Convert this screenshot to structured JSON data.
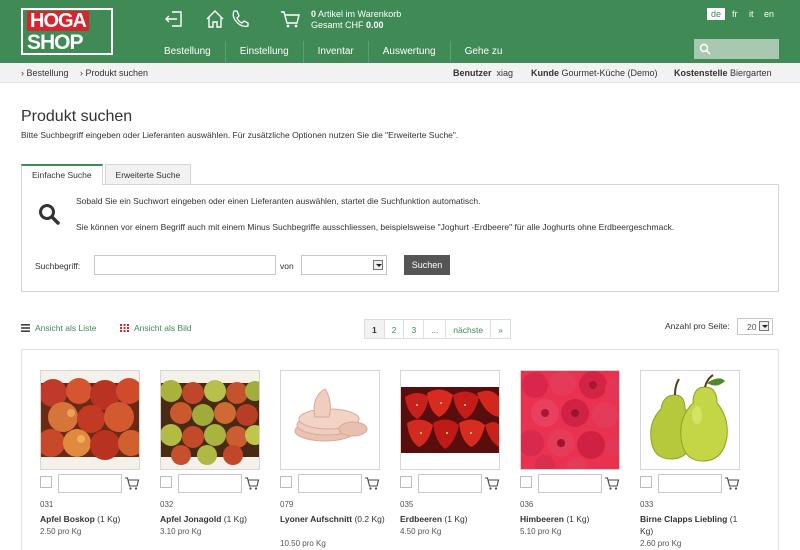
{
  "header": {
    "logo_top": "HOGA",
    "logo_bottom": "SHOP",
    "cart_count": "0",
    "cart_label": "Artikel im Warenkorb",
    "total_label": "Gesamt CHF",
    "total_value": "0.00",
    "languages": [
      "de",
      "fr",
      "it",
      "en"
    ],
    "active_language": "de",
    "nav": [
      "Bestellung",
      "Einstellung",
      "Inventar",
      "Auswertung",
      "Gehe zu"
    ]
  },
  "breadcrumb": [
    "Bestellung",
    "Produkt suchen"
  ],
  "userbar": {
    "user_label": "Benutzer",
    "user_value": "xiag",
    "customer_label": "Kunde",
    "customer_value": "Gourmet-Küche (Demo)",
    "cost_label": "Kostenstelle",
    "cost_value": "Biergarten"
  },
  "page": {
    "title": "Produkt suchen",
    "subtitle": "Bitte Suchbegriff eingeben oder Lieferanten auswählen. Für zusätzliche Optionen nutzen Sie die \"Erweiterte Suche\"."
  },
  "tabs": [
    "Einfache Suche",
    "Erweiterte Suche"
  ],
  "search": {
    "hint1": "Sobald Sie ein Suchwort eingeben oder einen Lieferanten auswählen, startet die Suchfunktion automatisch.",
    "hint2": "Sie können vor einem Begriff auch mit einem Minus Suchbegriffe ausschliessen, beispielsweise \"Joghurt -Erdbeere\" für alle Joghurts ohne Erdbeergeschmack.",
    "term_label": "Suchbegriff:",
    "term_value": "",
    "from_label": "von",
    "supplier_value": "",
    "button": "Suchen"
  },
  "listing": {
    "view_list": "Ansicht als Liste",
    "view_image": "Ansicht als Bild",
    "pages": [
      "1",
      "2",
      "3",
      "...",
      "nächste",
      "»"
    ],
    "current_page": "1",
    "per_page_label": "Anzahl pro Seite:",
    "per_page_value": "20"
  },
  "colors": {
    "brand": "#3f8a55",
    "logo_red": "#d9232d"
  },
  "products": [
    {
      "number": "031",
      "name": "Apfel Boskop",
      "unit": "(1 Kg)",
      "price": "2.50 pro Kg",
      "image": "red-apples"
    },
    {
      "number": "032",
      "name": "Apfel Jonagold",
      "unit": "(1 Kg)",
      "price": "3.10 pro Kg",
      "image": "mixed-apples"
    },
    {
      "number": "079",
      "name": "Lyoner Aufschnitt",
      "unit": "(0.2 Kg)",
      "price": "10.50 pro Kg",
      "image": "sliced-sausage"
    },
    {
      "number": "035",
      "name": "Erdbeeren",
      "unit": "(1 Kg)",
      "price": "4.50 pro Kg",
      "image": "strawberries"
    },
    {
      "number": "036",
      "name": "Himbeeren",
      "unit": "(1 Kg)",
      "price": "5.10 pro Kg",
      "image": "raspberries"
    },
    {
      "number": "033",
      "name": "Birne Clapps Liebling",
      "unit": "(1 Kg)",
      "price": "2.60 pro Kg",
      "image": "green-pears"
    }
  ]
}
